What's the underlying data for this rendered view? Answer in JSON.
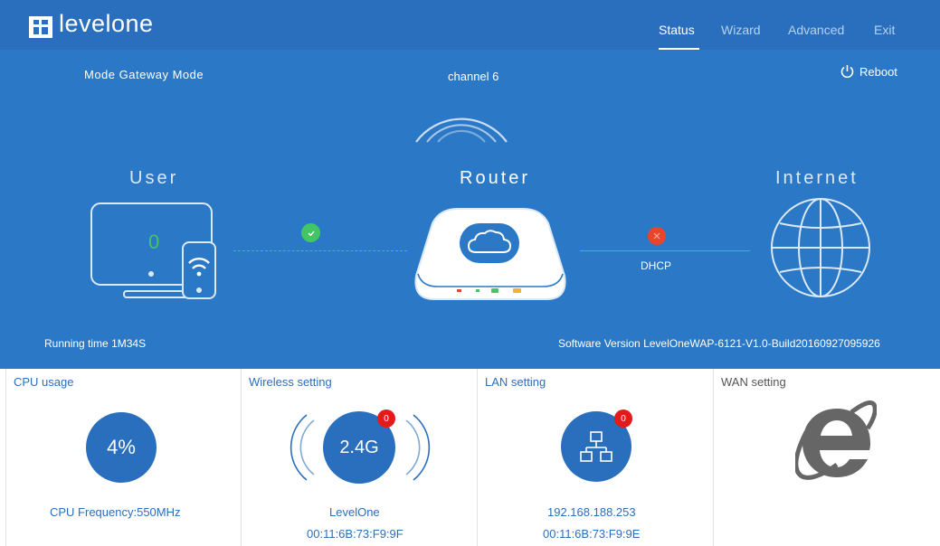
{
  "brand": {
    "name": "levelone"
  },
  "nav": {
    "status": "Status",
    "wizard": "Wizard",
    "advanced": "Advanced",
    "exit": "Exit"
  },
  "status": {
    "mode_label": "Mode",
    "mode_value": "Gateway Mode",
    "channel_label": "channel",
    "channel_value": "6",
    "reboot": "Reboot",
    "user": "User",
    "router": "Router",
    "internet": "Internet",
    "user_count": "0",
    "wan_type": "DHCP",
    "running_label": "Running time",
    "running_value": "1M34S",
    "sw_label": "Software Version",
    "sw_value": "LevelOneWAP-6121-V1.0-Build20160927095926"
  },
  "panels": {
    "cpu": {
      "title": "CPU usage",
      "usage": "4%",
      "freq": "CPU Frequency:550MHz"
    },
    "wireless": {
      "title": "Wireless setting",
      "band": "2.4G",
      "badge": "0",
      "ssid": "LevelOne",
      "mac": "00:11:6B:73:F9:9F"
    },
    "lan": {
      "title": "LAN setting",
      "badge": "0",
      "ip": "192.168.188.253",
      "mac": "00:11:6B:73:F9:9E"
    },
    "wan": {
      "title": "WAN setting"
    }
  },
  "colors": {
    "banner": "#2a78c6",
    "header": "#2a6fbd",
    "ok": "#43c564",
    "error": "#e8452c",
    "badge": "#e31b1b"
  }
}
